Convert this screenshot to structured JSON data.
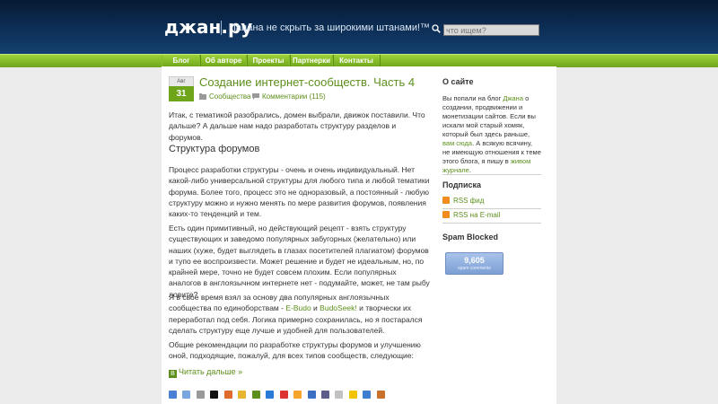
{
  "header": {
    "logo": "джан.ру",
    "tagline": "Пацана не скрыть за широкими штанами!™",
    "search_placeholder": "что ищем?"
  },
  "nav": {
    "items": [
      "Блог",
      "Об авторе",
      "Проекты",
      "Партнерки",
      "Контакты"
    ]
  },
  "post": {
    "date_month": "Авг",
    "date_day": "31",
    "title": "Создание интернет-сообществ. Часть 4",
    "category": "Сообщества",
    "comments": "Комментарии (115)",
    "intro": "Итак, с тематикой разобрались, домен выбрали, движок поставили. Что дальше? А дальше нам надо разработать структуру разделов и форумов.",
    "heading": "Структура форумов",
    "p1": "Процесс разработки структуры - очень и очень индивидуальный. Нет какой-либо универсальной структуры для любого типа и любой тематики форума. Более того, процесс это не одноразовый, а постоянный - любую структуру можно и нужно менять по мере развития форумов, появления каких-то тенденций и тем.",
    "p2": "Есть один примитивный, но действующий рецепт - взять структуру существующих и заведомо популярных забугорных (желательно) или наших (хуже, будет выглядеть в глазах посетителей плагиатом) форумов и тупо ее воспроизвести. Может решение и будет не идеальным, но, по крайней мере, точно не будет совсем плохим. Если популярных аналогов в англоязычном интернете нет - подумайте, может, не там рыбу ловите?",
    "p3_a": "Я в свое время взял за основу два популярных англоязычных сообщества по единоборствам - ",
    "p3_link1": "E-Budo",
    "p3_and": " и ",
    "p3_link2": "BudoSeek!",
    "p3_b": " и творчески их переработал под себя. Логика примерно сохранилась, но я постарался сделать структуру еще лучше и удобней для пользователей.",
    "p4": "Общие рекомендации по разработке структуры форумов и улучшению оной, подходящие, пожалуй, для всех типов сообществ, следующие:",
    "read_more": "Читать дальше »"
  },
  "sidebar": {
    "about_title": "О сайте",
    "about_a": "Вы попали на блог ",
    "about_link1": "Джана",
    "about_b": " о создании, продвижении и монетизации сайтов. Если вы искали мой старый хомяк, который был здесь раньше, ",
    "about_link2": "вам сюда",
    "about_c": ". А всякую всячину, не имеющую отношения к теме этого блога, я пишу в ",
    "about_link3": "живом журнале",
    "about_d": ".",
    "subscribe_title": "Подписка",
    "rss_feed": "RSS фид",
    "rss_email": "RSS на E-mail",
    "spam_title": "Spam Blocked",
    "spam_count": "9,605",
    "spam_label": "spam comments"
  },
  "colors": {
    "header_bg": "#0d2f57",
    "nav_green": "#7fb623",
    "link_green": "#5d8f1c",
    "spam_blue": "#8aaddc"
  },
  "icons": [
    "search-icon",
    "folder-icon",
    "comment-icon",
    "read-more-icon",
    "rss-icon",
    "share-icon"
  ]
}
